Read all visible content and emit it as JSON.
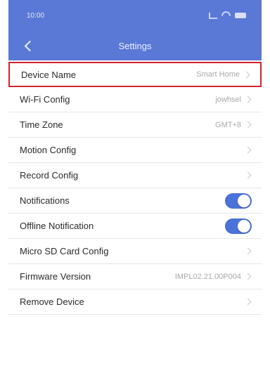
{
  "status_bar": {
    "time": "10:00"
  },
  "header": {
    "title": "Settings",
    "accent": "#5a78d6"
  },
  "rows": [
    {
      "label": "Device Name",
      "value": "Smart Home",
      "type": "chevron"
    },
    {
      "label": "Wi-Fi Config",
      "value": "jowhsel",
      "type": "chevron"
    },
    {
      "label": "Time Zone",
      "value": "GMT+8",
      "type": "chevron"
    },
    {
      "label": "Motion Config",
      "value": "",
      "type": "chevron"
    },
    {
      "label": "Record Config",
      "value": "",
      "type": "chevron"
    },
    {
      "label": "Notifications",
      "value": "on",
      "type": "toggle"
    },
    {
      "label": "Offline Notification",
      "value": "on",
      "type": "toggle"
    },
    {
      "label": "Micro SD Card Config",
      "value": "",
      "type": "chevron"
    },
    {
      "label": "Firmware Version",
      "value": "IMPL02.21.00P004",
      "type": "chevron"
    },
    {
      "label": "Remove Device",
      "value": "",
      "type": "chevron"
    }
  ],
  "highlight_color": "#d4222a",
  "toggle_color": "#4a72d8"
}
